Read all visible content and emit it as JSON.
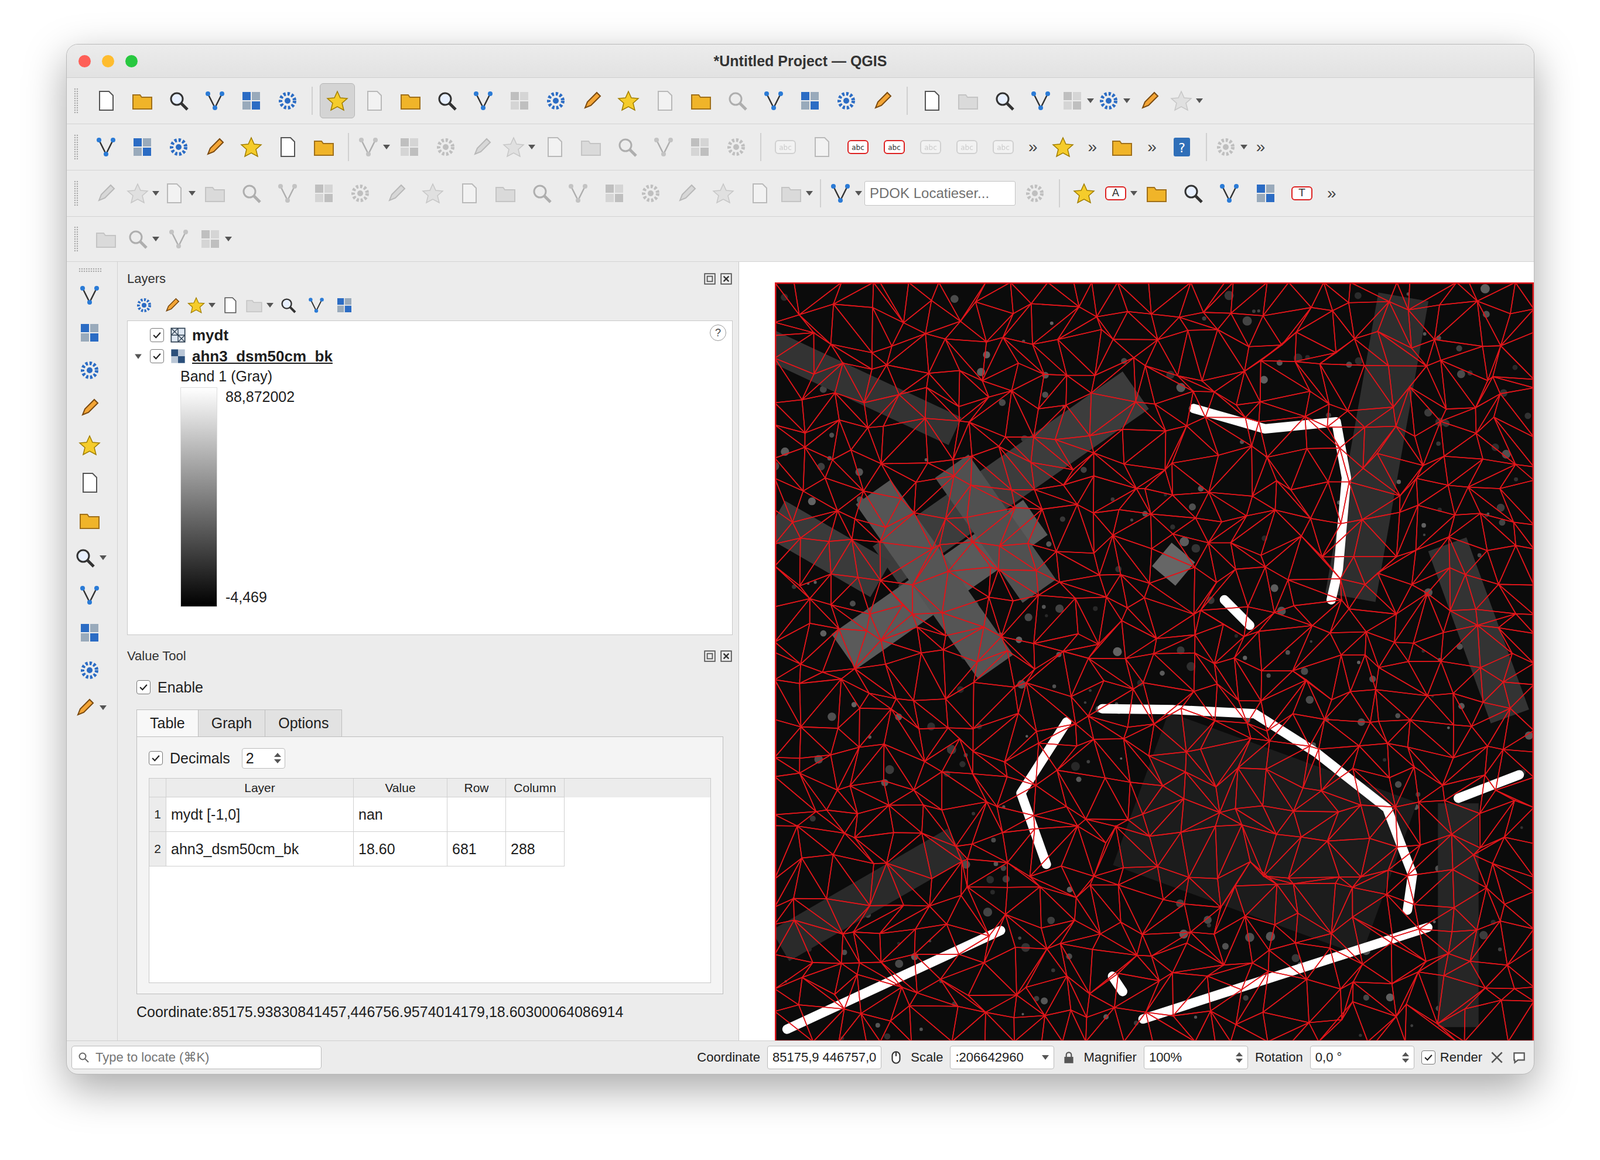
{
  "window": {
    "title": "*Untitled Project — QGIS"
  },
  "toolbars": [
    [
      {
        "kind": "icon",
        "disabled": false,
        "pressed": false,
        "dropdown": false
      },
      {
        "kind": "icon",
        "disabled": false,
        "pressed": false,
        "dropdown": false
      },
      {
        "kind": "icon",
        "disabled": false,
        "pressed": false,
        "dropdown": false
      },
      {
        "kind": "icon",
        "disabled": false,
        "pressed": false,
        "dropdown": false
      },
      {
        "kind": "icon",
        "disabled": false,
        "pressed": false,
        "dropdown": false
      },
      {
        "kind": "icon",
        "disabled": false,
        "pressed": false,
        "dropdown": false
      },
      {
        "kind": "sep"
      },
      {
        "kind": "icon",
        "disabled": false,
        "pressed": true,
        "dropdown": false
      },
      {
        "kind": "icon",
        "disabled": true,
        "pressed": false,
        "dropdown": false
      },
      {
        "kind": "icon",
        "disabled": false,
        "pressed": false,
        "dropdown": false
      },
      {
        "kind": "icon",
        "disabled": false,
        "pressed": false,
        "dropdown": false
      },
      {
        "kind": "icon",
        "disabled": false,
        "pressed": false,
        "dropdown": false
      },
      {
        "kind": "icon",
        "disabled": true,
        "pressed": false,
        "dropdown": false
      },
      {
        "kind": "icon",
        "disabled": false,
        "pressed": false,
        "dropdown": false
      },
      {
        "kind": "icon",
        "disabled": false,
        "pressed": false,
        "dropdown": false
      },
      {
        "kind": "icon",
        "disabled": false,
        "pressed": false,
        "dropdown": false
      },
      {
        "kind": "icon",
        "disabled": true,
        "pressed": false,
        "dropdown": false
      },
      {
        "kind": "icon",
        "disabled": false,
        "pressed": false,
        "dropdown": false
      },
      {
        "kind": "icon",
        "disabled": true,
        "pressed": false,
        "dropdown": false
      },
      {
        "kind": "icon",
        "disabled": false,
        "pressed": false,
        "dropdown": false
      },
      {
        "kind": "icon",
        "disabled": false,
        "pressed": false,
        "dropdown": false
      },
      {
        "kind": "icon",
        "disabled": false,
        "pressed": false,
        "dropdown": false
      },
      {
        "kind": "icon",
        "disabled": false,
        "pressed": false,
        "dropdown": false
      },
      {
        "kind": "sep"
      },
      {
        "kind": "icon",
        "disabled": false,
        "pressed": false,
        "dropdown": false
      },
      {
        "kind": "icon",
        "disabled": true,
        "pressed": false,
        "dropdown": false
      },
      {
        "kind": "icon",
        "disabled": false,
        "pressed": false,
        "dropdown": false
      },
      {
        "kind": "icon",
        "disabled": false,
        "pressed": false,
        "dropdown": false
      },
      {
        "kind": "icon",
        "disabled": true,
        "pressed": false,
        "dropdown": true
      },
      {
        "kind": "icon",
        "disabled": false,
        "pressed": false,
        "dropdown": true
      },
      {
        "kind": "icon",
        "disabled": false,
        "pressed": false,
        "dropdown": false
      },
      {
        "kind": "icon",
        "disabled": true,
        "pressed": false,
        "dropdown": true
      }
    ],
    [
      {
        "kind": "icon",
        "disabled": false,
        "pressed": false,
        "dropdown": false
      },
      {
        "kind": "icon",
        "disabled": false,
        "pressed": false,
        "dropdown": false
      },
      {
        "kind": "icon",
        "disabled": false,
        "pressed": false,
        "dropdown": false
      },
      {
        "kind": "icon",
        "disabled": false,
        "pressed": false,
        "dropdown": false
      },
      {
        "kind": "icon",
        "disabled": false,
        "pressed": false,
        "dropdown": false
      },
      {
        "kind": "icon",
        "disabled": false,
        "pressed": false,
        "dropdown": false
      },
      {
        "kind": "icon",
        "disabled": false,
        "pressed": false,
        "dropdown": false
      },
      {
        "kind": "sep"
      },
      {
        "kind": "icon",
        "disabled": true,
        "pressed": false,
        "dropdown": true
      },
      {
        "kind": "icon",
        "disabled": true,
        "pressed": false,
        "dropdown": false
      },
      {
        "kind": "icon",
        "disabled": true,
        "pressed": false,
        "dropdown": false
      },
      {
        "kind": "icon",
        "disabled": true,
        "pressed": false,
        "dropdown": false
      },
      {
        "kind": "icon",
        "disabled": true,
        "pressed": false,
        "dropdown": true
      },
      {
        "kind": "icon",
        "disabled": true,
        "pressed": false,
        "dropdown": false
      },
      {
        "kind": "icon",
        "disabled": true,
        "pressed": false,
        "dropdown": false
      },
      {
        "kind": "icon",
        "disabled": true,
        "pressed": false,
        "dropdown": false
      },
      {
        "kind": "icon",
        "disabled": true,
        "pressed": false,
        "dropdown": false
      },
      {
        "kind": "icon",
        "disabled": true,
        "pressed": false,
        "dropdown": false
      },
      {
        "kind": "icon",
        "disabled": true,
        "pressed": false,
        "dropdown": false
      },
      {
        "kind": "sep"
      },
      {
        "kind": "icon",
        "disabled": true,
        "pressed": false,
        "dropdown": false,
        "text": "abc"
      },
      {
        "kind": "icon",
        "disabled": true,
        "pressed": false,
        "dropdown": false
      },
      {
        "kind": "icon",
        "disabled": false,
        "pressed": false,
        "dropdown": false,
        "text": "abc"
      },
      {
        "kind": "icon",
        "disabled": false,
        "pressed": false,
        "dropdown": false,
        "text": "abc"
      },
      {
        "kind": "icon",
        "disabled": true,
        "pressed": false,
        "dropdown": false,
        "text": "abc"
      },
      {
        "kind": "icon",
        "disabled": true,
        "pressed": false,
        "dropdown": false,
        "text": "abc"
      },
      {
        "kind": "icon",
        "disabled": true,
        "pressed": false,
        "dropdown": false,
        "text": "abc"
      },
      {
        "kind": "overflow",
        "text": "»"
      },
      {
        "kind": "icon",
        "disabled": false,
        "pressed": false,
        "dropdown": false
      },
      {
        "kind": "overflow",
        "text": "»"
      },
      {
        "kind": "icon",
        "disabled": false,
        "pressed": false,
        "dropdown": false
      },
      {
        "kind": "overflow",
        "text": "»"
      },
      {
        "kind": "icon",
        "disabled": false,
        "pressed": false,
        "dropdown": false,
        "text": "?"
      },
      {
        "kind": "sep"
      },
      {
        "kind": "icon",
        "disabled": true,
        "pressed": false,
        "dropdown": true
      },
      {
        "kind": "overflow",
        "text": "»"
      }
    ],
    [
      {
        "kind": "icon",
        "disabled": true,
        "pressed": false,
        "dropdown": false
      },
      {
        "kind": "icon",
        "disabled": true,
        "pressed": false,
        "dropdown": true
      },
      {
        "kind": "icon",
        "disabled": true,
        "pressed": false,
        "dropdown": true
      },
      {
        "kind": "icon",
        "disabled": true,
        "pressed": false,
        "dropdown": false
      },
      {
        "kind": "icon",
        "disabled": true,
        "pressed": false,
        "dropdown": false
      },
      {
        "kind": "icon",
        "disabled": true,
        "pressed": false,
        "dropdown": false
      },
      {
        "kind": "icon",
        "disabled": true,
        "pressed": false,
        "dropdown": false
      },
      {
        "kind": "icon",
        "disabled": true,
        "pressed": false,
        "dropdown": false
      },
      {
        "kind": "icon",
        "disabled": true,
        "pressed": false,
        "dropdown": false
      },
      {
        "kind": "icon",
        "disabled": true,
        "pressed": false,
        "dropdown": false
      },
      {
        "kind": "icon",
        "disabled": true,
        "pressed": false,
        "dropdown": false
      },
      {
        "kind": "icon",
        "disabled": true,
        "pressed": false,
        "dropdown": false
      },
      {
        "kind": "icon",
        "disabled": true,
        "pressed": false,
        "dropdown": false
      },
      {
        "kind": "icon",
        "disabled": true,
        "pressed": false,
        "dropdown": false
      },
      {
        "kind": "icon",
        "disabled": true,
        "pressed": false,
        "dropdown": false
      },
      {
        "kind": "icon",
        "disabled": true,
        "pressed": false,
        "dropdown": false
      },
      {
        "kind": "icon",
        "disabled": true,
        "pressed": false,
        "dropdown": false
      },
      {
        "kind": "icon",
        "disabled": true,
        "pressed": false,
        "dropdown": false
      },
      {
        "kind": "icon",
        "disabled": true,
        "pressed": false,
        "dropdown": false
      },
      {
        "kind": "icon",
        "disabled": true,
        "pressed": false,
        "dropdown": true
      },
      {
        "kind": "sep"
      },
      {
        "kind": "icon",
        "disabled": false,
        "pressed": false,
        "dropdown": true
      },
      {
        "kind": "search",
        "placeholder": "PDOK Locatieser..."
      },
      {
        "kind": "icon",
        "disabled": true,
        "pressed": false,
        "dropdown": false
      },
      {
        "kind": "sep"
      },
      {
        "kind": "icon",
        "disabled": false,
        "pressed": false,
        "dropdown": false
      },
      {
        "kind": "icon",
        "disabled": false,
        "pressed": false,
        "dropdown": true,
        "text": "A"
      },
      {
        "kind": "icon",
        "disabled": false,
        "pressed": false,
        "dropdown": false
      },
      {
        "kind": "icon",
        "disabled": false,
        "pressed": false,
        "dropdown": false
      },
      {
        "kind": "icon",
        "disabled": false,
        "pressed": false,
        "dropdown": false
      },
      {
        "kind": "icon",
        "disabled": false,
        "pressed": false,
        "dropdown": false
      },
      {
        "kind": "icon",
        "disabled": false,
        "pressed": false,
        "dropdown": false,
        "text": "T"
      },
      {
        "kind": "overflow",
        "text": "»"
      }
    ],
    [
      {
        "kind": "icon",
        "disabled": true,
        "pressed": false,
        "dropdown": false
      },
      {
        "kind": "icon",
        "disabled": true,
        "pressed": false,
        "dropdown": true
      },
      {
        "kind": "icon",
        "disabled": true,
        "pressed": false,
        "dropdown": false
      },
      {
        "kind": "icon",
        "disabled": true,
        "pressed": false,
        "dropdown": true
      }
    ]
  ],
  "side_toolbar": [
    {
      "disabled": false,
      "dropdown": false
    },
    {
      "disabled": false,
      "dropdown": false
    },
    {
      "disabled": false,
      "dropdown": false
    },
    {
      "disabled": false,
      "dropdown": false
    },
    {
      "disabled": false,
      "dropdown": false
    },
    {
      "disabled": false,
      "dropdown": false
    },
    {
      "disabled": false,
      "dropdown": false
    },
    {
      "disabled": false,
      "dropdown": true
    },
    {
      "disabled": false,
      "dropdown": false
    },
    {
      "disabled": false,
      "dropdown": false
    },
    {
      "disabled": false,
      "dropdown": false
    },
    {
      "disabled": false,
      "dropdown": true
    }
  ],
  "layers_panel": {
    "title": "Layers",
    "help": "?",
    "tools": [
      {
        "disabled": false,
        "dropdown": false
      },
      {
        "disabled": false,
        "dropdown": false
      },
      {
        "disabled": false,
        "dropdown": true
      },
      {
        "disabled": false,
        "dropdown": false
      },
      {
        "disabled": true,
        "dropdown": true
      },
      {
        "disabled": false,
        "dropdown": false
      },
      {
        "disabled": false,
        "dropdown": false
      },
      {
        "disabled": false,
        "dropdown": false
      }
    ],
    "layers": [
      {
        "name": "mydt",
        "checked": true,
        "expandable": false,
        "expanded": false,
        "current": false,
        "kind": "mesh"
      },
      {
        "name": "ahn3_dsm50cm_bk",
        "checked": true,
        "expandable": true,
        "expanded": true,
        "current": true,
        "kind": "raster"
      }
    ],
    "legend": {
      "band": "Band 1 (Gray)",
      "max": "88,872002",
      "min": "-4,469"
    }
  },
  "value_tool": {
    "title": "Value Tool",
    "enable": {
      "label": "Enable",
      "checked": true
    },
    "tabs": [
      {
        "label": "Table",
        "selected": true
      },
      {
        "label": "Graph",
        "selected": false
      },
      {
        "label": "Options",
        "selected": false
      }
    ],
    "decimals": {
      "label": "Decimals",
      "checked": true,
      "value": "2"
    },
    "columns": [
      "Layer",
      "Value",
      "Row",
      "Column"
    ],
    "rows": [
      {
        "index": "1",
        "cells": [
          "mydt [-1,0]",
          "nan",
          "",
          ""
        ]
      },
      {
        "index": "2",
        "cells": [
          "ahn3_dsm50cm_bk",
          "18.60",
          "681",
          "288"
        ]
      }
    ],
    "coordinate": "Coordinate:85175.93830841457,446756.9574014179,18.60300064086914"
  },
  "status_bar": {
    "search_placeholder": "Type to locate (⌘K)",
    "coordinate_label": "Coordinate",
    "coordinate": "85175,9 446757,0",
    "scale_label": "Scale",
    "scale": ":206642960",
    "magnifier_label": "Magnifier",
    "magnifier": "100%",
    "rotation_label": "Rotation",
    "rotation": "0,0 °",
    "render": {
      "label": "Render",
      "checked": true
    }
  }
}
